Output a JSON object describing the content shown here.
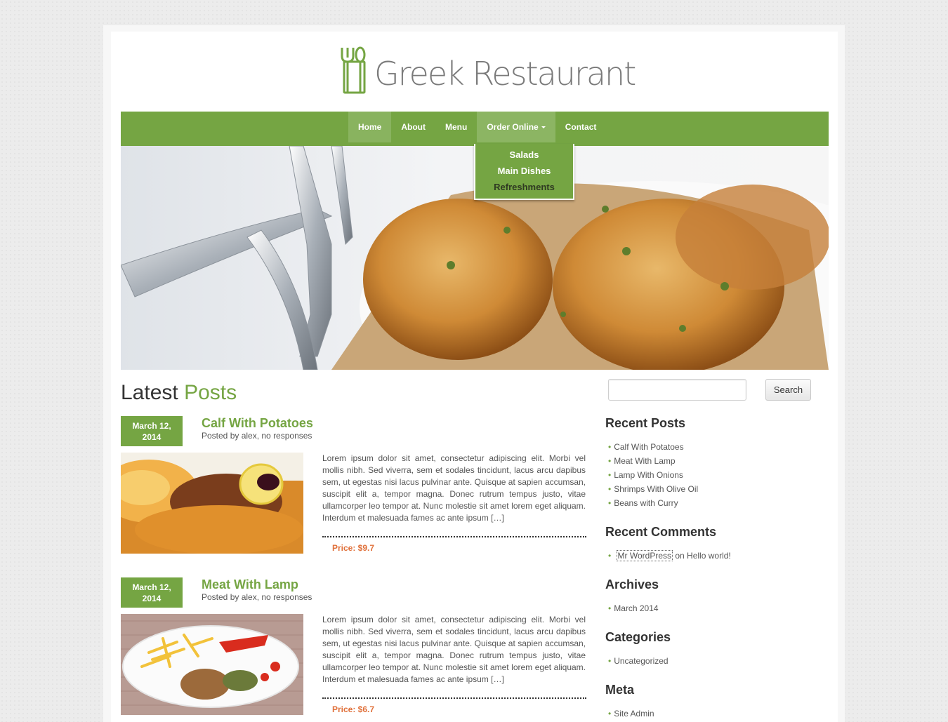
{
  "site": {
    "logo_text": "Greek Restaurant"
  },
  "nav": {
    "items": [
      {
        "label": "Home"
      },
      {
        "label": "About"
      },
      {
        "label": "Menu"
      },
      {
        "label": "Order Online"
      },
      {
        "label": "Contact"
      }
    ],
    "dropdown": [
      {
        "label": "Salads"
      },
      {
        "label": "Main Dishes"
      },
      {
        "label": "Refreshments"
      }
    ]
  },
  "main": {
    "title_part1": "Latest",
    "title_part2": "Posts",
    "posts": [
      {
        "date_line1": "March 12,",
        "date_line2": "2014",
        "title": "Calf With Potatoes",
        "meta": "Posted by alex, no responses",
        "excerpt": "Lorem ipsum dolor sit amet, consectetur adipiscing elit. Morbi vel mollis nibh. Sed viverra, sem et sodales tincidunt, lacus arcu dapibus sem, ut egestas nisi lacus pulvinar ante. Quisque at sapien accumsan, suscipit elit a, tempor magna. Donec rutrum tempus justo, vitae ullamcorper leo tempor at. Nunc molestie sit amet lorem eget aliquam. Interdum et malesuada fames ac ante ipsum […]",
        "price": "Price: $9.7"
      },
      {
        "date_line1": "March 12,",
        "date_line2": "2014",
        "title": "Meat With Lamp",
        "meta": "Posted by alex, no responses",
        "excerpt": "Lorem ipsum dolor sit amet, consectetur adipiscing elit. Morbi vel mollis nibh. Sed viverra, sem et sodales tincidunt, lacus arcu dapibus sem, ut egestas nisi lacus pulvinar ante. Quisque at sapien accumsan, suscipit elit a, tempor magna. Donec rutrum tempus justo, vitae ullamcorper leo tempor at. Nunc molestie sit amet lorem eget aliquam. Interdum et malesuada fames ac ante ipsum […]",
        "price": "Price: $6.7"
      }
    ]
  },
  "sidebar": {
    "search_button": "Search",
    "recent_posts_title": "Recent Posts",
    "recent_posts": [
      "Calf With Potatoes",
      "Meat With Lamp",
      "Lamp With Onions",
      "Shrimps With Olive Oil",
      "Beans with Curry"
    ],
    "recent_comments_title": "Recent Comments",
    "comment": {
      "author": "Mr WordPress",
      "on_text": "on",
      "post": "Hello world!"
    },
    "archives_title": "Archives",
    "archives": [
      "March 2014"
    ],
    "categories_title": "Categories",
    "categories": [
      "Uncategorized"
    ],
    "meta_title": "Meta",
    "meta": [
      "Site Admin"
    ]
  },
  "colors": {
    "brand_green": "#75a543",
    "price_orange": "#e0703a"
  }
}
